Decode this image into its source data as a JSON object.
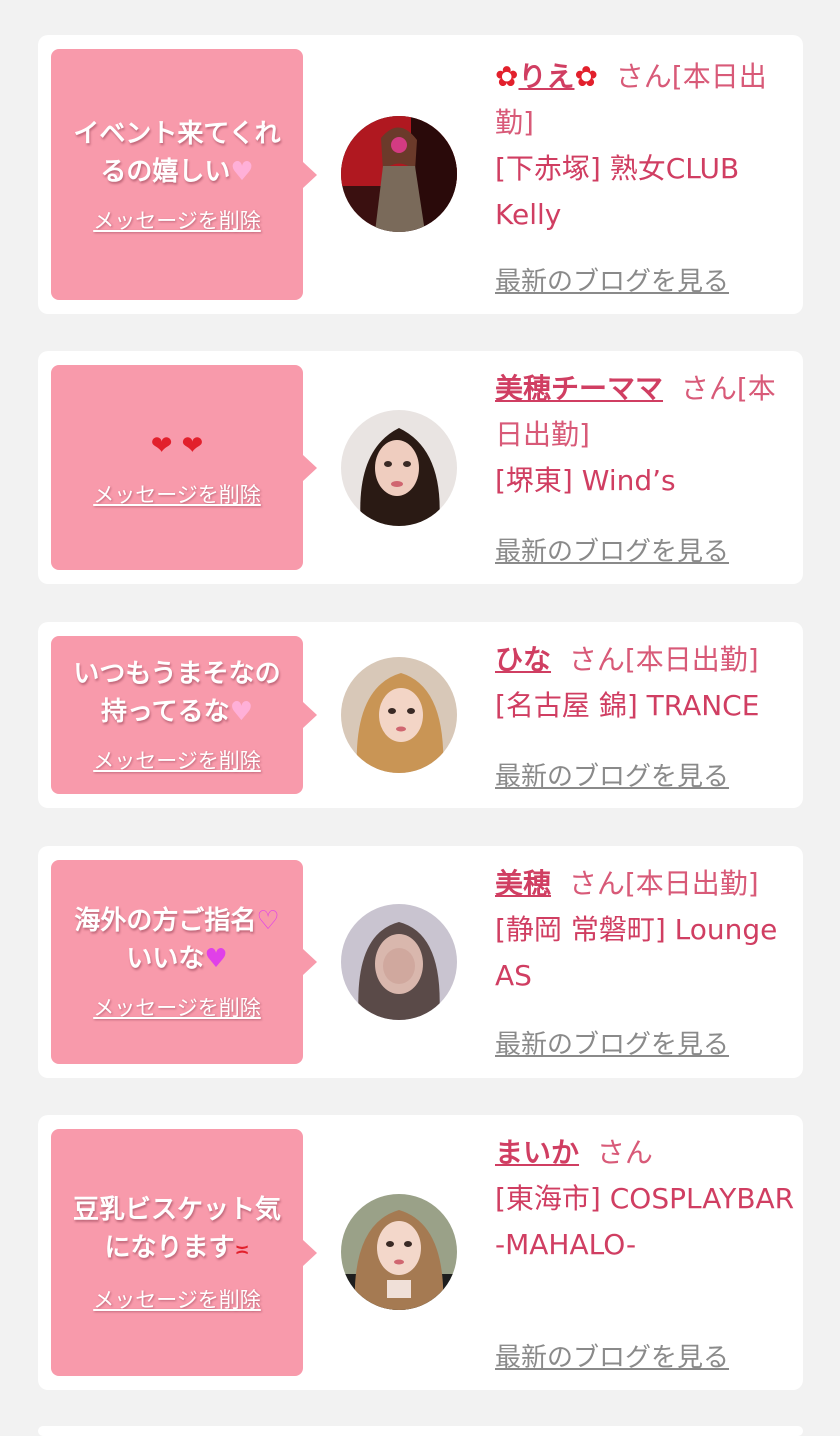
{
  "cards": [
    {
      "message_line1": "イベント来てくれ",
      "message_line2": "るの嬉しい",
      "delete_label": "メッセージを削除",
      "name": "りえ",
      "status": "さん[本日出勤]",
      "shop": "[下赤塚] 熟女CLUB Kelly",
      "blog_label": "最新のブログを見る"
    },
    {
      "message_line1": "",
      "delete_label": "メッセージを削除",
      "name": "美穂チーママ",
      "status": "さん[本日出勤]",
      "shop": "[堺東] Wind’s",
      "blog_label": "最新のブログを見る"
    },
    {
      "message_line1": "いつもうまそなの",
      "message_line2": "持ってるな",
      "delete_label": "メッセージを削除",
      "name": "ひな",
      "status": "さん[本日出勤]",
      "shop": "[名古屋 錦] TRANCE",
      "blog_label": "最新のブログを見る"
    },
    {
      "message_line1": "海外の方ご指名",
      "message_line2": "いいな",
      "delete_label": "メッセージを削除",
      "name": "美穂",
      "status": "さん[本日出勤]",
      "shop": "[静岡 常磐町] Lounge AS",
      "blog_label": "最新のブログを見る"
    },
    {
      "message_line1": "豆乳ビスケット気",
      "message_line2": "になります",
      "delete_label": "メッセージを削除",
      "name": "まいか",
      "status": "さん",
      "shop": "[東海市] COSPLAYBAR -MAHALO-",
      "blog_label": "最新のブログを見る"
    }
  ],
  "icons": {
    "rose": "rose-icon",
    "heart": "pink-heart-icon",
    "sparkle_hearts": "beating-heart-icon",
    "heart_eyes": "heart-eyes-icon",
    "sparkling_heart": "sparkling-heart-icon",
    "confounded": "confounded-face-icon"
  },
  "colors": {
    "bubble": "#f89aab",
    "accent": "#d03e62",
    "link_gray": "#8a8a8a",
    "background": "#f2f2f2"
  }
}
